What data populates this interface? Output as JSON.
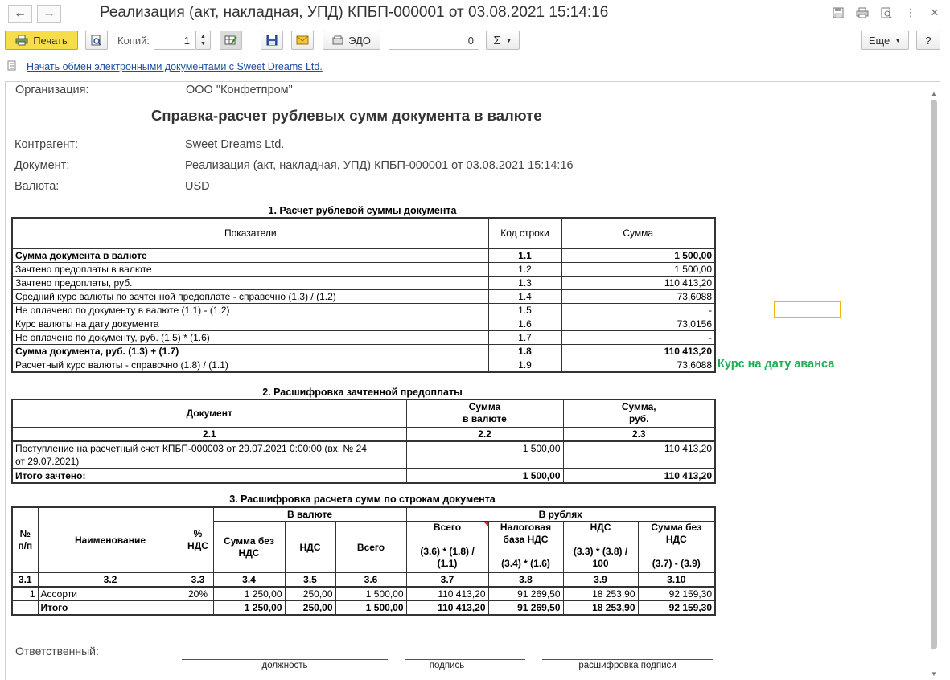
{
  "window": {
    "title": "Реализация (акт, накладная, УПД) КПБП-000001 от 03.08.2021 15:14:16",
    "nav_back": "←",
    "nav_forward": "→"
  },
  "toolbar": {
    "print_label": "Печать",
    "copies_label": "Копий:",
    "copies_value": "1",
    "edo_label": "ЭДО",
    "sum_value": "0",
    "sigma_label": "Σ",
    "more_label": "Еще",
    "help_label": "?"
  },
  "edo_link": "Начать обмен электронными документами с Sweet Dreams Ltd.",
  "report": {
    "org_label": "Организация:",
    "org_value": "ООО \"Конфетпром\"",
    "title": "Справка-расчет рублевых сумм документа в валюте",
    "contractor_label": "Контрагент:",
    "contractor_value": "Sweet Dreams Ltd.",
    "doc_label": "Документ:",
    "doc_value": "Реализация (акт, накладная, УПД) КПБП-000001 от 03.08.2021 15:14:16",
    "currency_label": "Валюта:",
    "currency_value": "USD",
    "s1": {
      "title": "1. Расчет рублевой суммы документа",
      "headers": [
        "Показатели",
        "Код строки",
        "Сумма"
      ],
      "rows": [
        {
          "name": "Сумма документа в валюте",
          "code": "1.1",
          "sum": "1 500,00",
          "bold": true
        },
        {
          "name": "Зачтено предоплаты в валюте",
          "code": "1.2",
          "sum": "1 500,00"
        },
        {
          "name": "Зачтено предоплаты, руб.",
          "code": "1.3",
          "sum": "110 413,20"
        },
        {
          "name": "Средний курс валюты по зачтенной предоплате - справочно  (1.3) / (1.2)",
          "code": "1.4",
          "sum": "73,6088"
        },
        {
          "name": "Не оплачено по документу в валюте  (1.1) - (1.2)",
          "code": "1.5",
          "sum": "-"
        },
        {
          "name": "Курс валюты на дату документа",
          "code": "1.6",
          "sum": "73,0156"
        },
        {
          "name": "Не оплачено по документу, руб. (1.5) * (1.6)",
          "code": "1.7",
          "sum": "-"
        },
        {
          "name": "Сумма документа, руб. (1.3) + (1.7)",
          "code": "1.8",
          "sum": "110 413,20",
          "bold": true
        },
        {
          "name": "Расчетный курс валюты - справочно (1.8) / (1.1)",
          "code": "1.9",
          "sum": "73,6088"
        }
      ]
    },
    "annotation": "Курс на дату аванса",
    "s2": {
      "title": "2. Расшифровка зачтенной предоплаты",
      "h_doc": "Документ",
      "h_sum_cur_1": "Сумма",
      "h_sum_cur_2": "в валюте",
      "h_sum_rub_1": "Сумма,",
      "h_sum_rub_2": "руб.",
      "codes": [
        "2.1",
        "2.2",
        "2.3"
      ],
      "row_doc_1": "Поступление на расчетный счет КПБП-000003 от 29.07.2021 0:00:00 (вх. № 24",
      "row_doc_2": "от 29.07.2021)",
      "row_cur": "1 500,00",
      "row_rub": "110 413,20",
      "total_label": "Итого зачтено:",
      "total_cur": "1 500,00",
      "total_rub": "110 413,20"
    },
    "s3": {
      "title": "3. Расшифровка расчета сумм по строкам документа",
      "h_num_1": "№",
      "h_num_2": "п/п",
      "h_name": "Наименование",
      "h_vat_1": "%",
      "h_vat_2": "НДС",
      "h_group_cur": "В валюте",
      "h_group_rub": "В рублях",
      "h_cur_novat_1": "Сумма без",
      "h_cur_novat_2": "НДС",
      "h_cur_vat": "НДС",
      "h_cur_total": "Всего",
      "h_rub_total": "Всего",
      "h_rub_total_f1": "(3.6) * (1.8) /",
      "h_rub_total_f2": "(1.1)",
      "h_rub_base_1": "Налоговая",
      "h_rub_base_2": "база НДС",
      "h_rub_base_f": "(3.4) * (1.6)",
      "h_rub_vat": "НДС",
      "h_rub_vat_f1": "(3.3) * (3.8) /",
      "h_rub_vat_f2": "100",
      "h_rub_novat_1": "Сумма без",
      "h_rub_novat_2": "НДС",
      "h_rub_novat_f": "(3.7) - (3.9)",
      "codes": [
        "3.1",
        "3.2",
        "3.3",
        "3.4",
        "3.5",
        "3.6",
        "3.7",
        "3.8",
        "3.9",
        "3.10"
      ],
      "row": [
        "1",
        "Ассорти",
        "20%",
        "1 250,00",
        "250,00",
        "1 500,00",
        "110 413,20",
        "91 269,50",
        "18 253,90",
        "92 159,30"
      ],
      "total": [
        "",
        "Итого",
        "",
        "1 250,00",
        "250,00",
        "1 500,00",
        "110 413,20",
        "91 269,50",
        "18 253,90",
        "92 159,30"
      ]
    },
    "responsible_label": "Ответственный:",
    "sign_position": "должность",
    "sign_signature": "подпись",
    "sign_decode": "расшифровка подписи"
  },
  "colors": {
    "print_button": "#f8dd4a",
    "annotation": "#1fae55",
    "highlight_box": "#f2b500",
    "link": "#1f4fa0"
  }
}
